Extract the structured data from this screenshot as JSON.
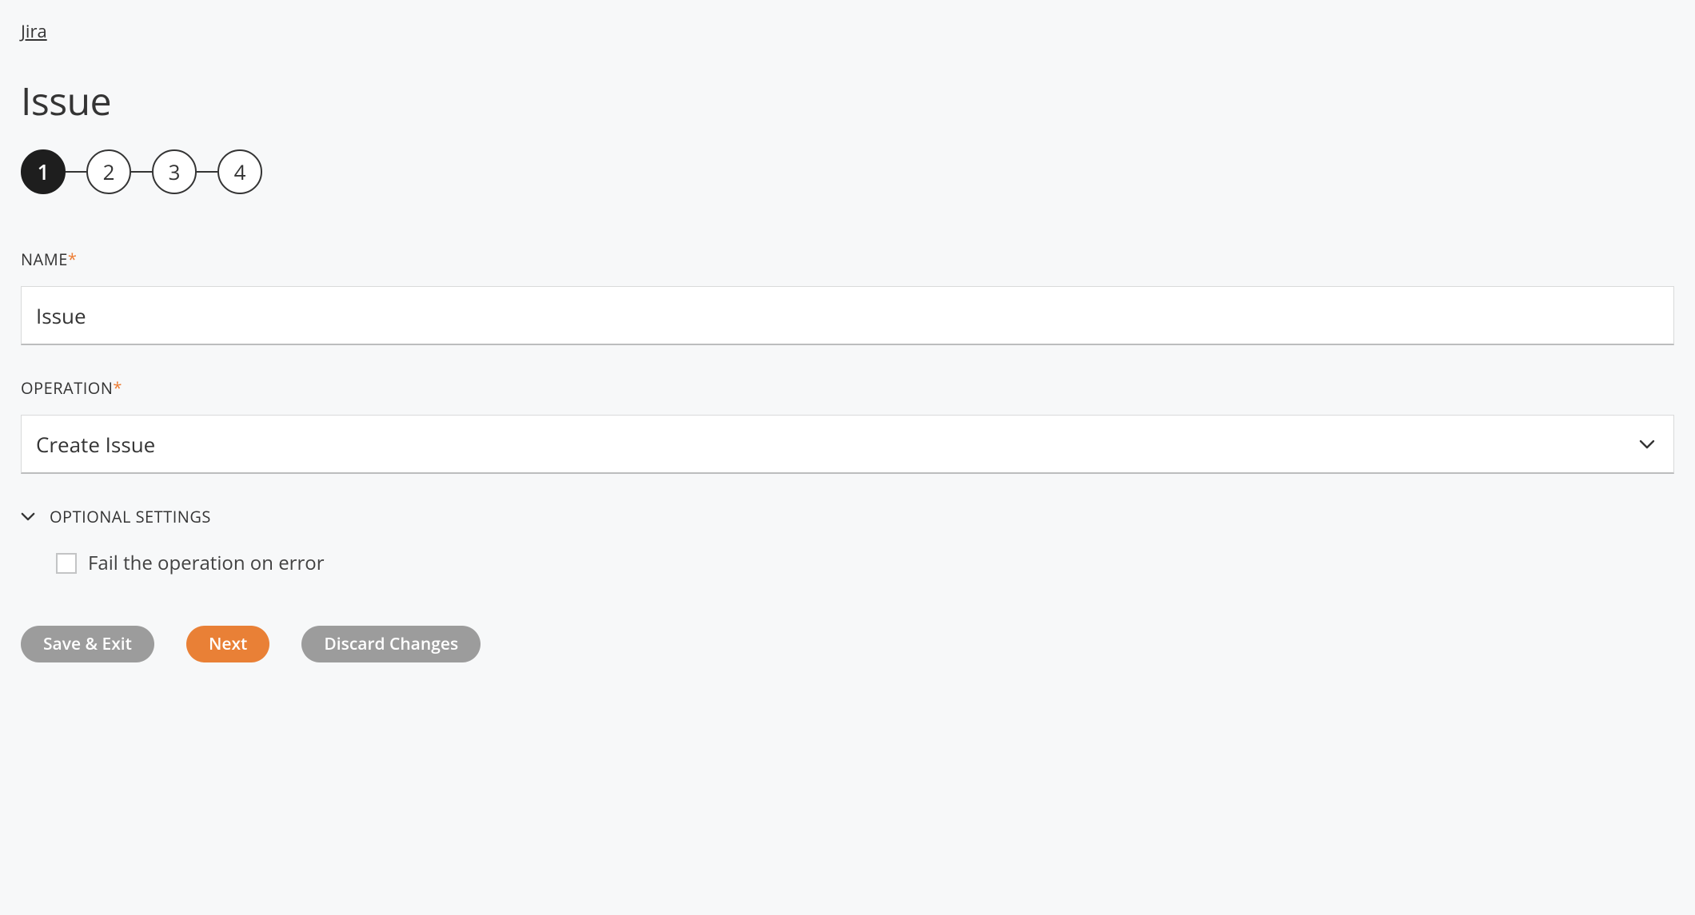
{
  "breadcrumb": {
    "label": "Jira"
  },
  "title": "Issue",
  "stepper": {
    "steps": [
      "1",
      "2",
      "3",
      "4"
    ],
    "active_index": 0
  },
  "fields": {
    "name": {
      "label": "NAME",
      "required": true,
      "value": "Issue"
    },
    "operation": {
      "label": "OPERATION",
      "required": true,
      "value": "Create Issue"
    }
  },
  "optional": {
    "header": "OPTIONAL SETTINGS",
    "expanded": true,
    "fail_on_error": {
      "label": "Fail the operation on error",
      "checked": false
    }
  },
  "buttons": {
    "save_exit": "Save & Exit",
    "next": "Next",
    "discard": "Discard Changes"
  }
}
